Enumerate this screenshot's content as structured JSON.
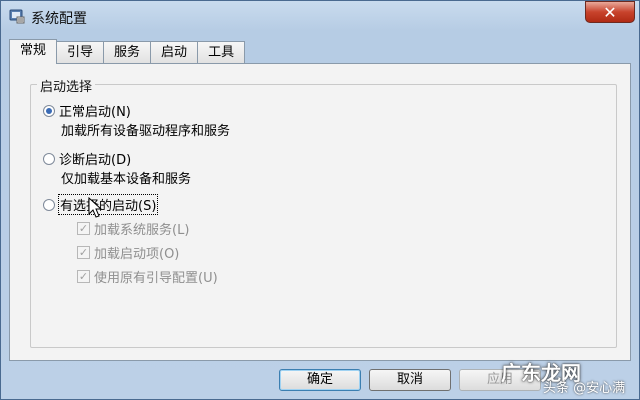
{
  "window": {
    "title": "系统配置",
    "close_glyph": "✕"
  },
  "tabs": [
    "常规",
    "引导",
    "服务",
    "启动",
    "工具"
  ],
  "group": {
    "title": "启动选择"
  },
  "options": [
    {
      "label": "正常启动(N)",
      "desc": "加载所有设备驱动程序和服务",
      "selected": true
    },
    {
      "label": "诊断启动(D)",
      "desc": "仅加载基本设备和服务",
      "selected": false
    },
    {
      "label": "有选择的启动(S)",
      "desc": "",
      "selected": false
    }
  ],
  "checkboxes": [
    {
      "label": "加载系统服务(L)",
      "checked": true,
      "enabled": false
    },
    {
      "label": "加载启动项(O)",
      "checked": true,
      "enabled": false
    },
    {
      "label": "使用原有引导配置(U)",
      "checked": true,
      "enabled": false
    }
  ],
  "buttons": {
    "ok": "确定",
    "cancel": "取消",
    "apply": "应用"
  },
  "watermark": {
    "main": "广东龙网",
    "sub": "头条 @安心满"
  }
}
